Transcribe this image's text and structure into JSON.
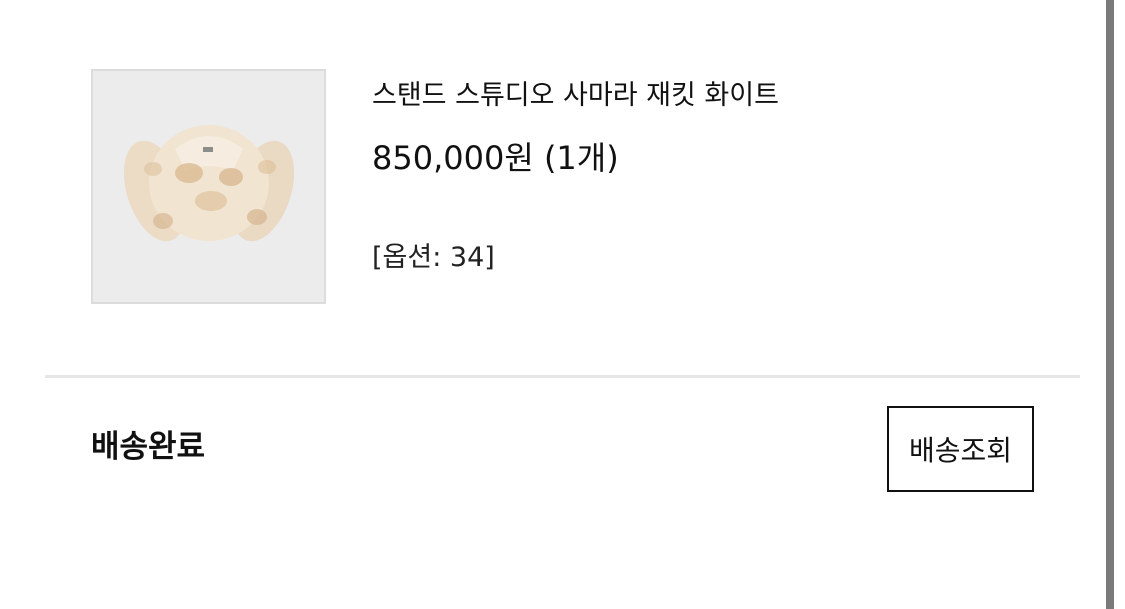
{
  "order_item": {
    "product_name": "스탠드 스튜디오 사마라 재킷 화이트",
    "price": "850,000원 (1개)",
    "option": "[옵션: 34]",
    "image_icon": "fur-jacket-thumbnail"
  },
  "delivery": {
    "status": "배송완료",
    "track_button_label": "배송조회"
  }
}
